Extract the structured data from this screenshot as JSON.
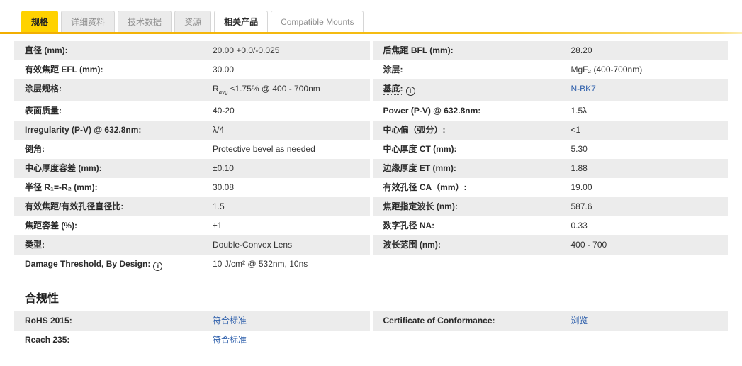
{
  "tabs": {
    "items": [
      {
        "label": "规格",
        "state": "active"
      },
      {
        "label": "详细资料",
        "state": "inactive"
      },
      {
        "label": "技术数据",
        "state": "inactive"
      },
      {
        "label": "资源",
        "state": "inactive"
      },
      {
        "label": "相关产品",
        "state": "plain-dark"
      },
      {
        "label": "Compatible Mounts",
        "state": "plain-muted"
      }
    ]
  },
  "specs": {
    "rows": [
      {
        "l_label": "直径 (mm):",
        "l_value": "20.00 +0.0/-0.025",
        "r_label": "后焦距 BFL (mm):",
        "r_value": "28.20"
      },
      {
        "l_label": "有效焦距 EFL (mm):",
        "l_value": "30.00",
        "r_label": "涂层:",
        "r_value": "MgF₂ (400-700nm)"
      },
      {
        "l_label": "涂层规格:",
        "l_value_html": "R<sub>avg</sub> ≤1.75% @ 400 - 700nm",
        "r_label": "基底:",
        "r_value": "N-BK7"
      },
      {
        "l_label": "表面质量:",
        "l_value": "40-20",
        "r_label": "Power (P-V) @ 632.8nm:",
        "r_value": "1.5λ"
      },
      {
        "l_label": "Irregularity (P-V) @ 632.8nm:",
        "l_value": "λ/4",
        "r_label": "中心偏（弧分）:",
        "r_value": "<1"
      },
      {
        "l_label": "倒角:",
        "l_value": "Protective bevel as needed",
        "r_label": "中心厚度 CT (mm):",
        "r_value": "5.30"
      },
      {
        "l_label": "中心厚度容差 (mm):",
        "l_value": "±0.10",
        "r_label": "边缘厚度 ET (mm):",
        "r_value": "1.88"
      },
      {
        "l_label": "半径 R₁=-R₂ (mm):",
        "l_value": "30.08",
        "r_label": "有效孔径 CA（mm）:",
        "r_value": "19.00"
      },
      {
        "l_label": "有效焦距/有效孔径直径比:",
        "l_value": "1.5",
        "r_label": "焦距指定波长 (nm):",
        "r_value": "587.6"
      },
      {
        "l_label": "焦距容差 (%):",
        "l_value": "±1",
        "r_label": "数字孔径 NA:",
        "r_value": "0.33"
      },
      {
        "l_label": "类型:",
        "l_value": "Double-Convex Lens",
        "r_label": "波长范围 (nm):",
        "r_value": "400 - 700"
      },
      {
        "l_label": "Damage Threshold, By Design:",
        "l_value": "10 J/cm² @ 532nm, 10ns",
        "r_label": "",
        "r_value": ""
      }
    ]
  },
  "compliance": {
    "heading": "合规性",
    "rows": [
      {
        "l_label": "RoHS 2015:",
        "l_value": "符合标准",
        "r_label": "Certificate of Conformance:",
        "r_value": "浏览"
      },
      {
        "l_label": "Reach 235:",
        "l_value": "符合标准",
        "r_label": "",
        "r_value": ""
      }
    ]
  },
  "colors": {
    "accent_yellow": "#FFD200",
    "underline_gold": "#F2AE00",
    "row_gray": "#ECECEC",
    "link_blue": "#2A5CAA",
    "label_text": "#2B2B2B"
  }
}
